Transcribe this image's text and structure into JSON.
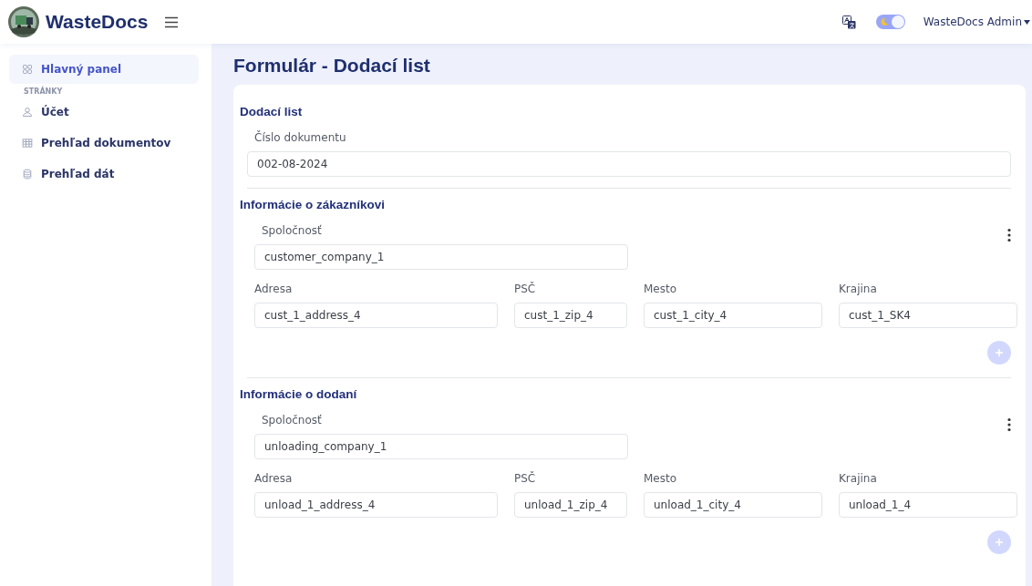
{
  "header": {
    "brand": "WasteDocs",
    "theme_toggle": {
      "on": true
    },
    "user": "WasteDocs Admin"
  },
  "sidebar": {
    "items": [
      {
        "kind": "link",
        "label": "Hlavný panel",
        "selected": true
      },
      {
        "kind": "heading",
        "label": "STRÁNKY"
      },
      {
        "kind": "link",
        "label": "Účet",
        "selected": false
      },
      {
        "kind": "link",
        "label": "Prehľad dokumentov",
        "selected": false
      },
      {
        "kind": "link",
        "label": "Prehľad dát",
        "selected": false
      }
    ]
  },
  "page_title": "Formulár - Dodací list",
  "sections": [
    {
      "kind": "document",
      "title": "Dodací list",
      "field": {
        "label": "Číslo dokumentu",
        "value": "002-08-2024"
      }
    },
    {
      "kind": "party",
      "title": "Informácie o zákazníkovi",
      "company": {
        "label": "Spoločnosť",
        "value": "customer_company_1"
      },
      "fields": [
        {
          "label": "Adresa",
          "value": "cust_1_address_4"
        },
        {
          "label": "PSČ",
          "value": "cust_1_zip_4"
        },
        {
          "label": "Mesto",
          "value": "cust_1_city_4"
        },
        {
          "label": "Krajina",
          "value": "cust_1_SK4"
        }
      ]
    },
    {
      "kind": "party",
      "title": "Informácie o dodaní",
      "company": {
        "label": "Spoločnosť",
        "value": "unloading_company_1"
      },
      "fields": [
        {
          "label": "Adresa",
          "value": "unload_1_address_4"
        },
        {
          "label": "PSČ",
          "value": "unload_1_zip_4"
        },
        {
          "label": "Mesto",
          "value": "unload_1_city_4"
        },
        {
          "label": "Krajina",
          "value": "unload_1_4"
        }
      ]
    }
  ]
}
